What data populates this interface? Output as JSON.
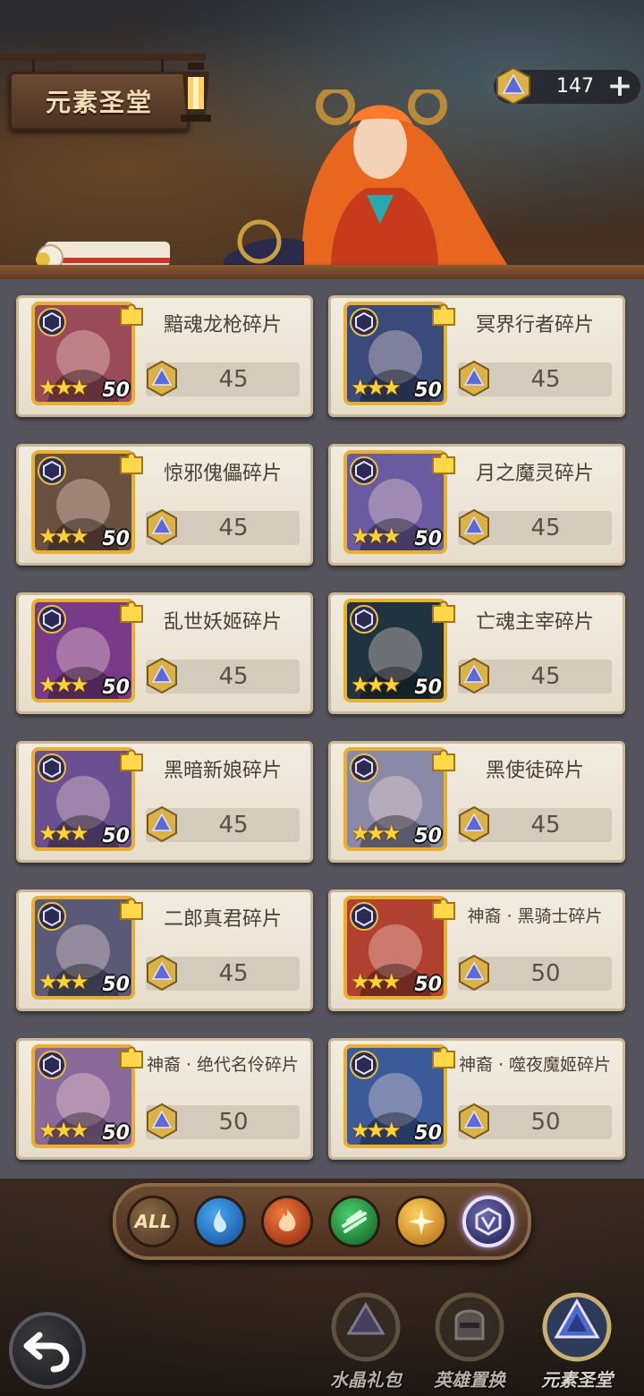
{
  "header": {
    "title": "元素圣堂",
    "currency": {
      "icon": "crystal-icon",
      "value": "147",
      "plus": "+"
    }
  },
  "items": [
    {
      "name": "黯魂龙枪碎片",
      "price": "45",
      "stars": "★★★",
      "level": "50",
      "color": "#9a4a58"
    },
    {
      "name": "冥界行者碎片",
      "price": "45",
      "stars": "★★★",
      "level": "50",
      "color": "#3a4a7a"
    },
    {
      "name": "惊邪傀儡碎片",
      "price": "45",
      "stars": "★★★",
      "level": "50",
      "color": "#6a5040"
    },
    {
      "name": "月之魔灵碎片",
      "price": "45",
      "stars": "★★★",
      "level": "50",
      "color": "#6a5aa0"
    },
    {
      "name": "乱世妖姬碎片",
      "price": "45",
      "stars": "★★★",
      "level": "50",
      "color": "#7a3a8a"
    },
    {
      "name": "亡魂主宰碎片",
      "price": "45",
      "stars": "★★★",
      "level": "50",
      "color": "#1f3440"
    },
    {
      "name": "黑暗新娘碎片",
      "price": "45",
      "stars": "★★★",
      "level": "50",
      "color": "#6a5090"
    },
    {
      "name": "黑使徒碎片",
      "price": "45",
      "stars": "★★★",
      "level": "50",
      "color": "#8a8aa8"
    },
    {
      "name": "二郎真君碎片",
      "price": "45",
      "stars": "★★★",
      "level": "50",
      "color": "#5a5a78"
    },
    {
      "name": "神裔 · 黑骑士碎片",
      "price": "50",
      "stars": "★★★",
      "level": "50",
      "color": "#b04030"
    },
    {
      "name": "神裔 · 绝代名伶碎片",
      "price": "50",
      "stars": "★★★",
      "level": "50",
      "color": "#8a6a9a"
    },
    {
      "name": "神裔 · 噬夜魔姬碎片",
      "price": "50",
      "stars": "★★★",
      "level": "50",
      "color": "#3a5a9a"
    }
  ],
  "filters": [
    {
      "label": "ALL",
      "icon": "all-filter-icon"
    },
    {
      "label": "",
      "icon": "water-element-icon",
      "color": "#1e6fc0"
    },
    {
      "label": "",
      "icon": "fire-element-icon",
      "color": "#c0401a"
    },
    {
      "label": "",
      "icon": "wind-element-icon",
      "color": "#1e8a3a"
    },
    {
      "label": "",
      "icon": "light-element-icon",
      "color": "#e09a18"
    },
    {
      "label": "",
      "icon": "dark-element-icon",
      "color": "#3a3a7a"
    }
  ],
  "bottom_nav": [
    {
      "label": "水晶礼包",
      "icon": "crystal-pack-icon"
    },
    {
      "label": "英雄置换",
      "icon": "hero-swap-icon"
    },
    {
      "label": "元素圣堂",
      "icon": "element-temple-icon"
    }
  ],
  "back_button": {
    "icon": "back-arrow-icon"
  }
}
